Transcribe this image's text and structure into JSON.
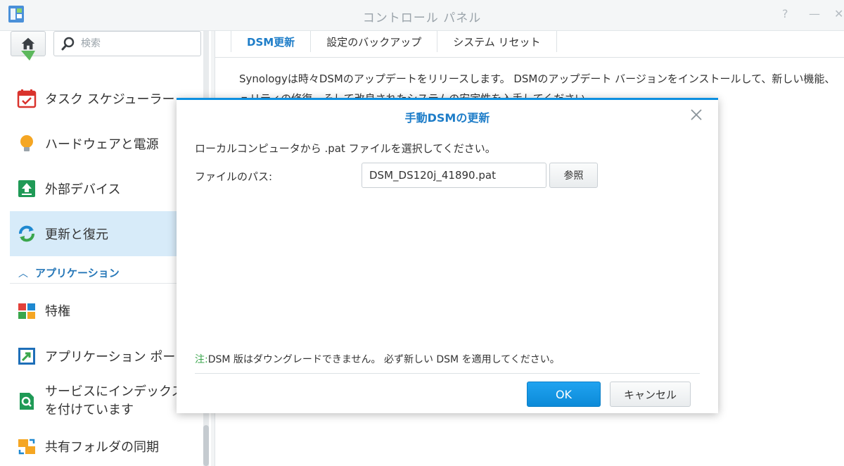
{
  "window": {
    "title": "コントロール パネル",
    "help_glyph": "?",
    "minimize_glyph": "—",
    "close_glyph": "✕"
  },
  "sidebar": {
    "search_placeholder": "検索",
    "items": [
      {
        "label": "タスク スケジューラー",
        "icon": "task-scheduler-icon"
      },
      {
        "label": "ハードウェアと電源",
        "icon": "lightbulb-icon"
      },
      {
        "label": "外部デバイス",
        "icon": "external-device-icon"
      },
      {
        "label": "更新と復元",
        "icon": "update-restore-icon",
        "active": true
      }
    ],
    "section_header": "アプリケーション",
    "app_items": [
      {
        "label": "特権",
        "icon": "privileges-icon"
      },
      {
        "label": "アプリケーション ポータル",
        "icon": "app-portal-icon"
      },
      {
        "label": "サービスにインデックスを付けています",
        "icon": "indexing-service-icon"
      },
      {
        "label": "共有フォルダの同期",
        "icon": "shared-folder-sync-icon"
      }
    ]
  },
  "main": {
    "tabs": [
      {
        "label": "DSM更新",
        "active": true
      },
      {
        "label": "設定のバックアップ"
      },
      {
        "label": "システム リセット"
      }
    ],
    "description_line1": "Synologyは時々DSMのアップデートをリリースします。 DSMのアップデート バージョンをインストールして、新しい機能、",
    "description_line2": "ュリティの修復、そして改良されたシステムの安定性を入手してください。"
  },
  "dialog": {
    "title": "手動DSMの更新",
    "instruction": "ローカルコンピュータから .pat ファイルを選択してください。",
    "path_label": "ファイルのパス:",
    "path_value": "DSM_DS120j_41890.pat",
    "browse_label": "参照",
    "note_prefix": "注:",
    "note_text": "DSM 版はダウングレードできません。 必ず新しい DSM を適用してください。",
    "ok_label": "OK",
    "cancel_label": "キャンセル"
  }
}
